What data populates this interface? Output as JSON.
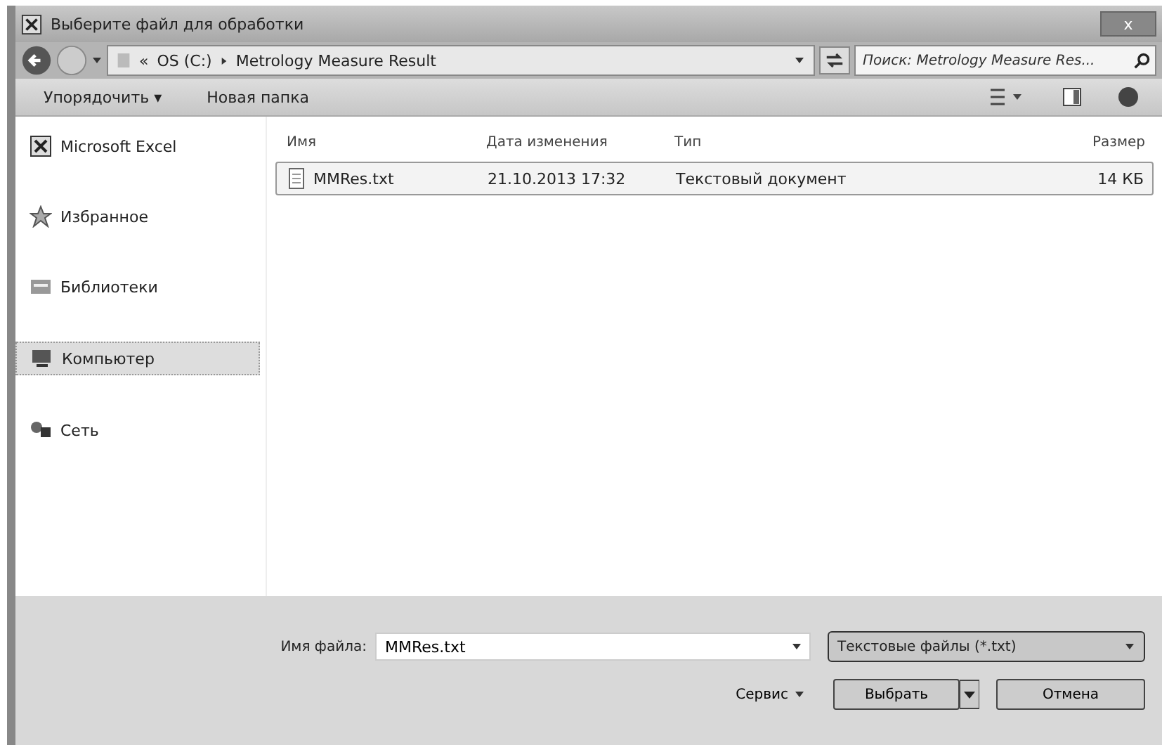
{
  "window": {
    "title": "Выберите файл для обработки",
    "close": "x"
  },
  "address": {
    "crumbs": [
      "«",
      "OS (C:)",
      "Metrology Measure Result"
    ]
  },
  "search": {
    "placeholder": "Поиск: Metrology Measure Res..."
  },
  "toolbar": {
    "items": [
      "Упорядочить ▾",
      "Новая папка"
    ]
  },
  "sidebar": {
    "items": [
      {
        "label": "Microsoft Excel",
        "kind": "excel",
        "selected": false
      },
      {
        "label": "Избранное",
        "kind": "star",
        "selected": false
      },
      {
        "label": "Библиотеки",
        "kind": "library",
        "selected": false
      },
      {
        "label": "Компьютер",
        "kind": "computer",
        "selected": true
      },
      {
        "label": "Сеть",
        "kind": "network",
        "selected": false
      }
    ]
  },
  "table": {
    "columns": [
      "Имя",
      "Дата изменения",
      "Тип",
      "Размер"
    ],
    "rows": [
      {
        "name": "MMRes.txt",
        "date": "21.10.2013 17:32",
        "type": "Текстовый документ",
        "size": "14 КБ",
        "selected": true
      }
    ]
  },
  "filename": {
    "label": "Имя файла:",
    "value": "MMRes.txt"
  },
  "filter": {
    "value": "Текстовые файлы (*.txt)"
  },
  "buttons": {
    "service": "Сервис",
    "open": "Выбрать",
    "cancel": "Отмена"
  }
}
